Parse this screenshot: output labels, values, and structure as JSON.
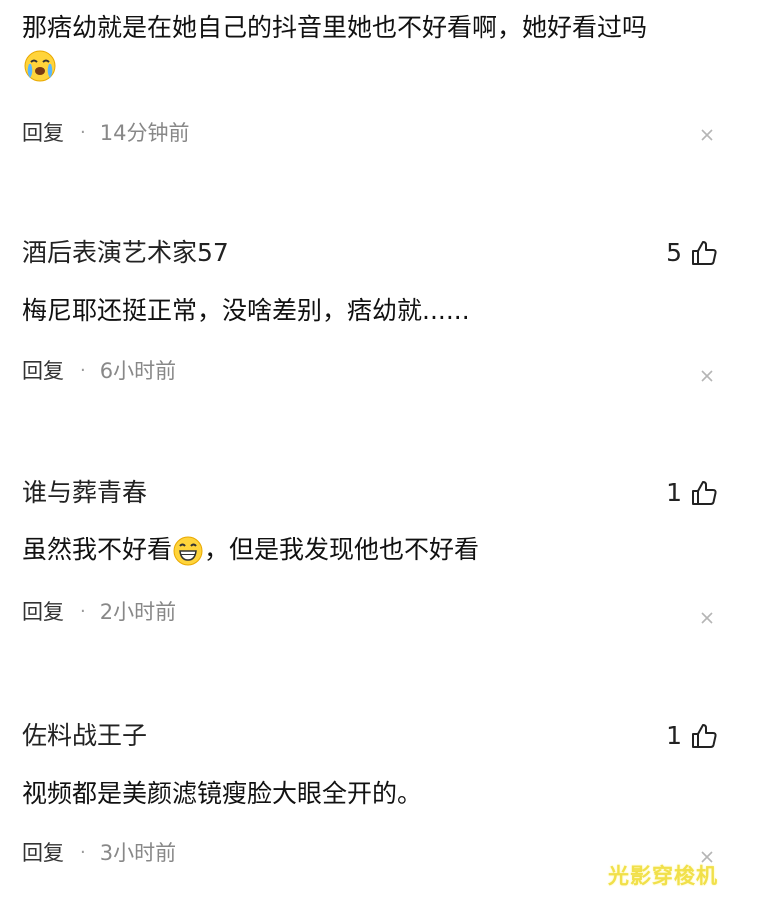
{
  "comments": [
    {
      "text": "那痞幼就是在她自己的抖音里她也不好看啊，她好看过吗",
      "emoji": "crying-face",
      "reply_label": "回复",
      "separator": "·",
      "time": "14分钟前"
    },
    {
      "username": "酒后表演艺术家57",
      "likes": "5",
      "text": "梅尼耶还挺正常，没啥差别，痞幼就......",
      "reply_label": "回复",
      "separator": "·",
      "time": "6小时前"
    },
    {
      "username": "谁与葬青春",
      "likes": "1",
      "text_before": "虽然我不好看",
      "emoji": "grinning-face",
      "text_after": "，但是我发现他也不好看",
      "reply_label": "回复",
      "separator": "·",
      "time": "2小时前"
    },
    {
      "username": "佐料战王子",
      "likes": "1",
      "text": "视频都是美颜滤镜瘦脸大眼全开的。",
      "reply_label": "回复",
      "separator": "·",
      "time": "3小时前"
    }
  ],
  "watermark": "光影穿梭机",
  "colors": {
    "text": "#111111",
    "meta": "#888888",
    "watermark": "#f1e04a"
  }
}
